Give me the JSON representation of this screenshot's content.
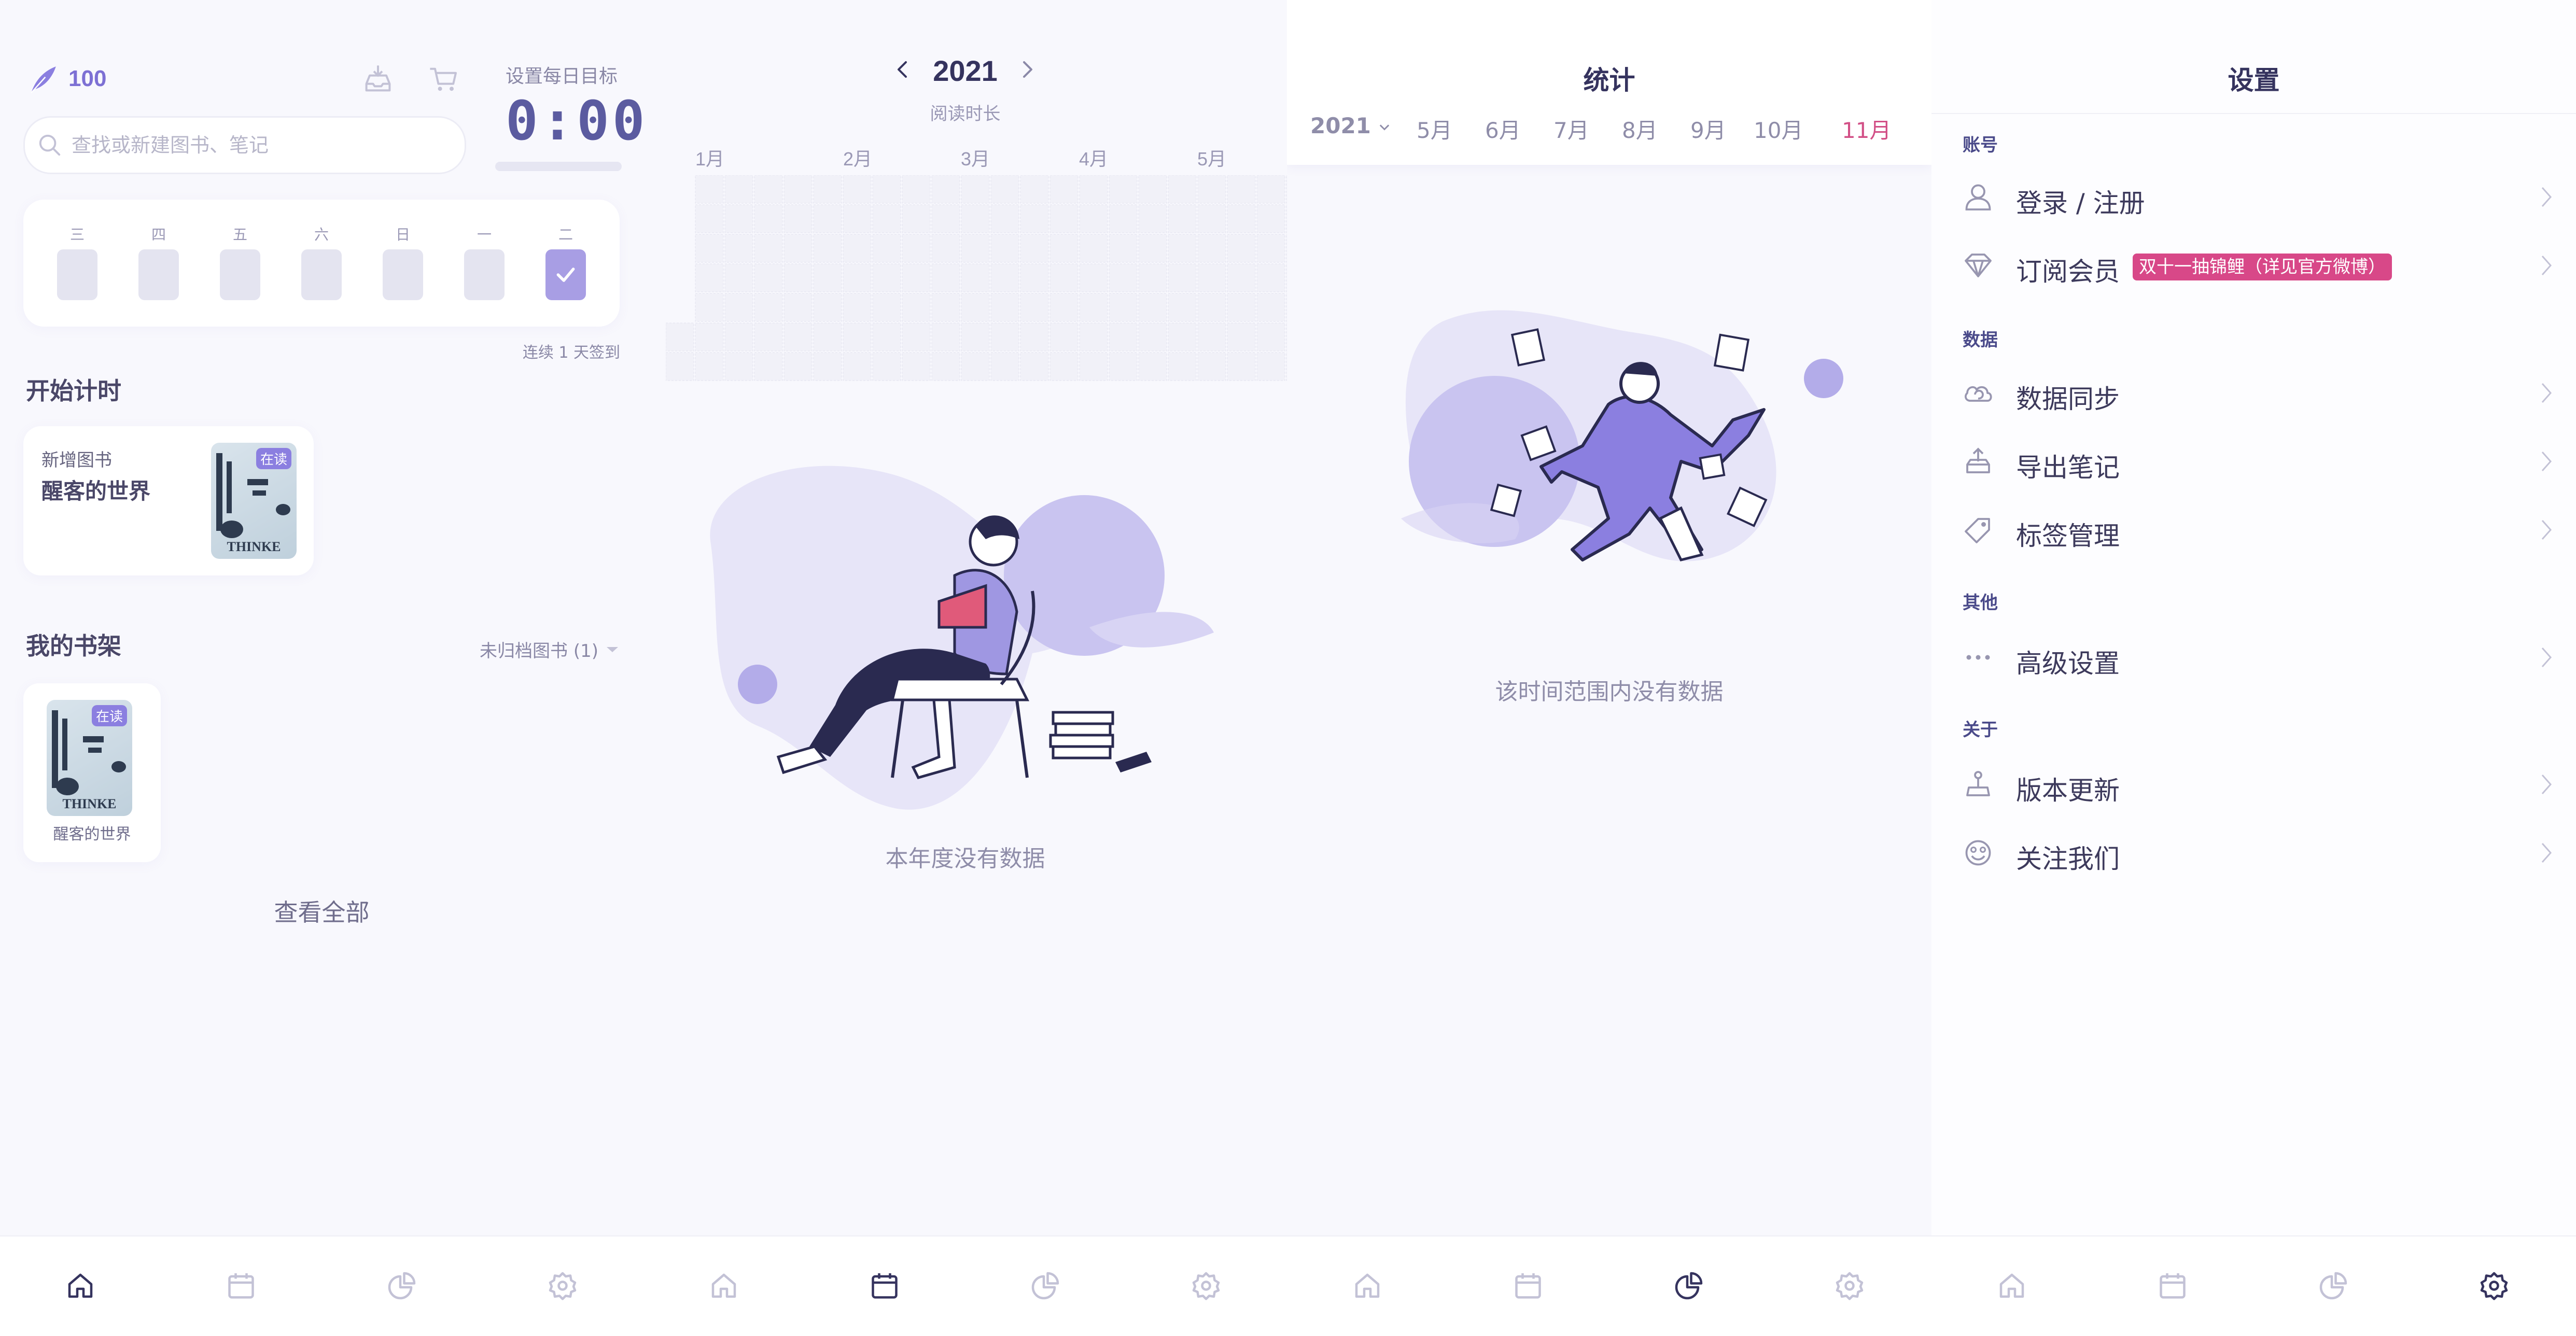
{
  "home": {
    "coins": "100",
    "goal_label": "设置每日目标",
    "goal_time": "0:00",
    "search_placeholder": "查找或新建图书、笔记",
    "weekdays": [
      "三",
      "四",
      "五",
      "六",
      "日",
      "一",
      "二"
    ],
    "checked_days": [
      false,
      false,
      false,
      false,
      false,
      false,
      true
    ],
    "streak_text": "连续 1 天签到",
    "timer_section": "开始计时",
    "new_book_label": "新增图书",
    "new_book_title": "醒客的世界",
    "shelf_section": "我的书架",
    "shelf_filter": "未归档图书 (1)",
    "shelf_books": [
      {
        "title": "醒客的世界",
        "status": "在读"
      }
    ],
    "reading_badge": "在读",
    "view_all": "查看全部"
  },
  "calendar": {
    "year": "2021",
    "subtitle": "阅读时长",
    "months": [
      "1月",
      "2月",
      "3月",
      "4月",
      "5月"
    ],
    "empty_text": "本年度没有数据"
  },
  "stats": {
    "title": "统计",
    "year_select": "2021",
    "months": [
      "5月",
      "6月",
      "7月",
      "8月",
      "9月",
      "10月",
      "11月"
    ],
    "active_month": "11月",
    "empty_text": "该时间范围内没有数据"
  },
  "settings": {
    "title": "设置",
    "groups": [
      {
        "label": "账号",
        "items": [
          {
            "icon": "user-icon",
            "label": "登录 / 注册"
          },
          {
            "icon": "diamond-icon",
            "label": "订阅会员",
            "promo": "双十一抽锦鲤（详见官方微博）"
          }
        ]
      },
      {
        "label": "数据",
        "items": [
          {
            "icon": "cloud-sync-icon",
            "label": "数据同步"
          },
          {
            "icon": "export-icon",
            "label": "导出笔记"
          },
          {
            "icon": "tag-icon",
            "label": "标签管理"
          }
        ]
      },
      {
        "label": "其他",
        "items": [
          {
            "icon": "more-icon",
            "label": "高级设置"
          }
        ]
      },
      {
        "label": "关于",
        "items": [
          {
            "icon": "update-icon",
            "label": "版本更新"
          },
          {
            "icon": "smile-icon",
            "label": "关注我们"
          }
        ]
      }
    ]
  },
  "nav": {
    "items": [
      "home-icon",
      "calendar-icon",
      "stats-icon",
      "settings-icon"
    ],
    "active_color": "#35335e",
    "inactive_color": "#c3c2d6"
  },
  "colors": {
    "accent": "#8b7fe0",
    "promo": "#d84888",
    "active_month": "#d24f86"
  }
}
